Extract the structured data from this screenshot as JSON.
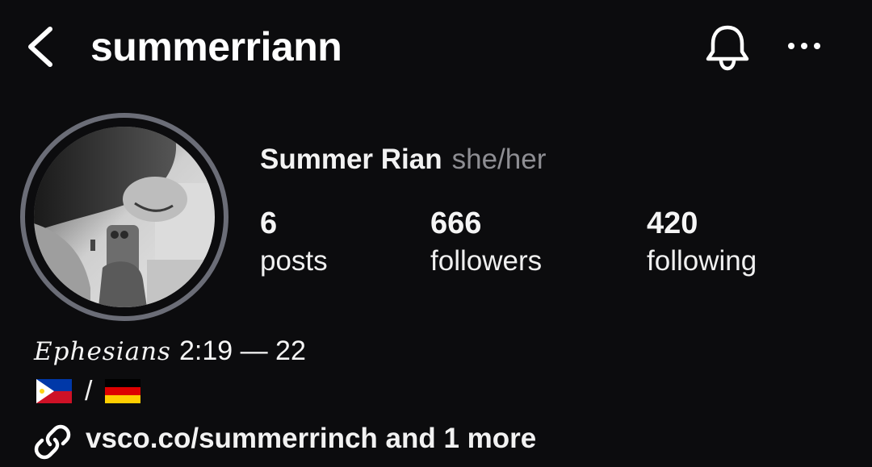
{
  "header": {
    "username": "summerriann",
    "back_icon": "chevron-left-icon",
    "notification_icon": "bell-icon",
    "more_icon": "more-horizontal-icon"
  },
  "profile": {
    "full_name": "Summer Rian",
    "pronouns": "she/her",
    "avatar": "profile-photo"
  },
  "stats": [
    {
      "value": "6",
      "label": "posts"
    },
    {
      "value": "666",
      "label": "followers"
    },
    {
      "value": "420",
      "label": "following"
    }
  ],
  "bio": {
    "line1_script": "Ephesians",
    "line1_ref": "2:19 — 22",
    "flags": [
      "philippines-flag",
      "germany-flag"
    ],
    "flag_separator": "/",
    "link_icon": "link-icon",
    "link_text": "vsco.co/summerrinch and 1 more"
  },
  "colors": {
    "background": "#0c0c0e",
    "text_primary": "#f5f5f5",
    "text_secondary": "#8e8e93",
    "avatar_ring": "#6b6d77"
  }
}
